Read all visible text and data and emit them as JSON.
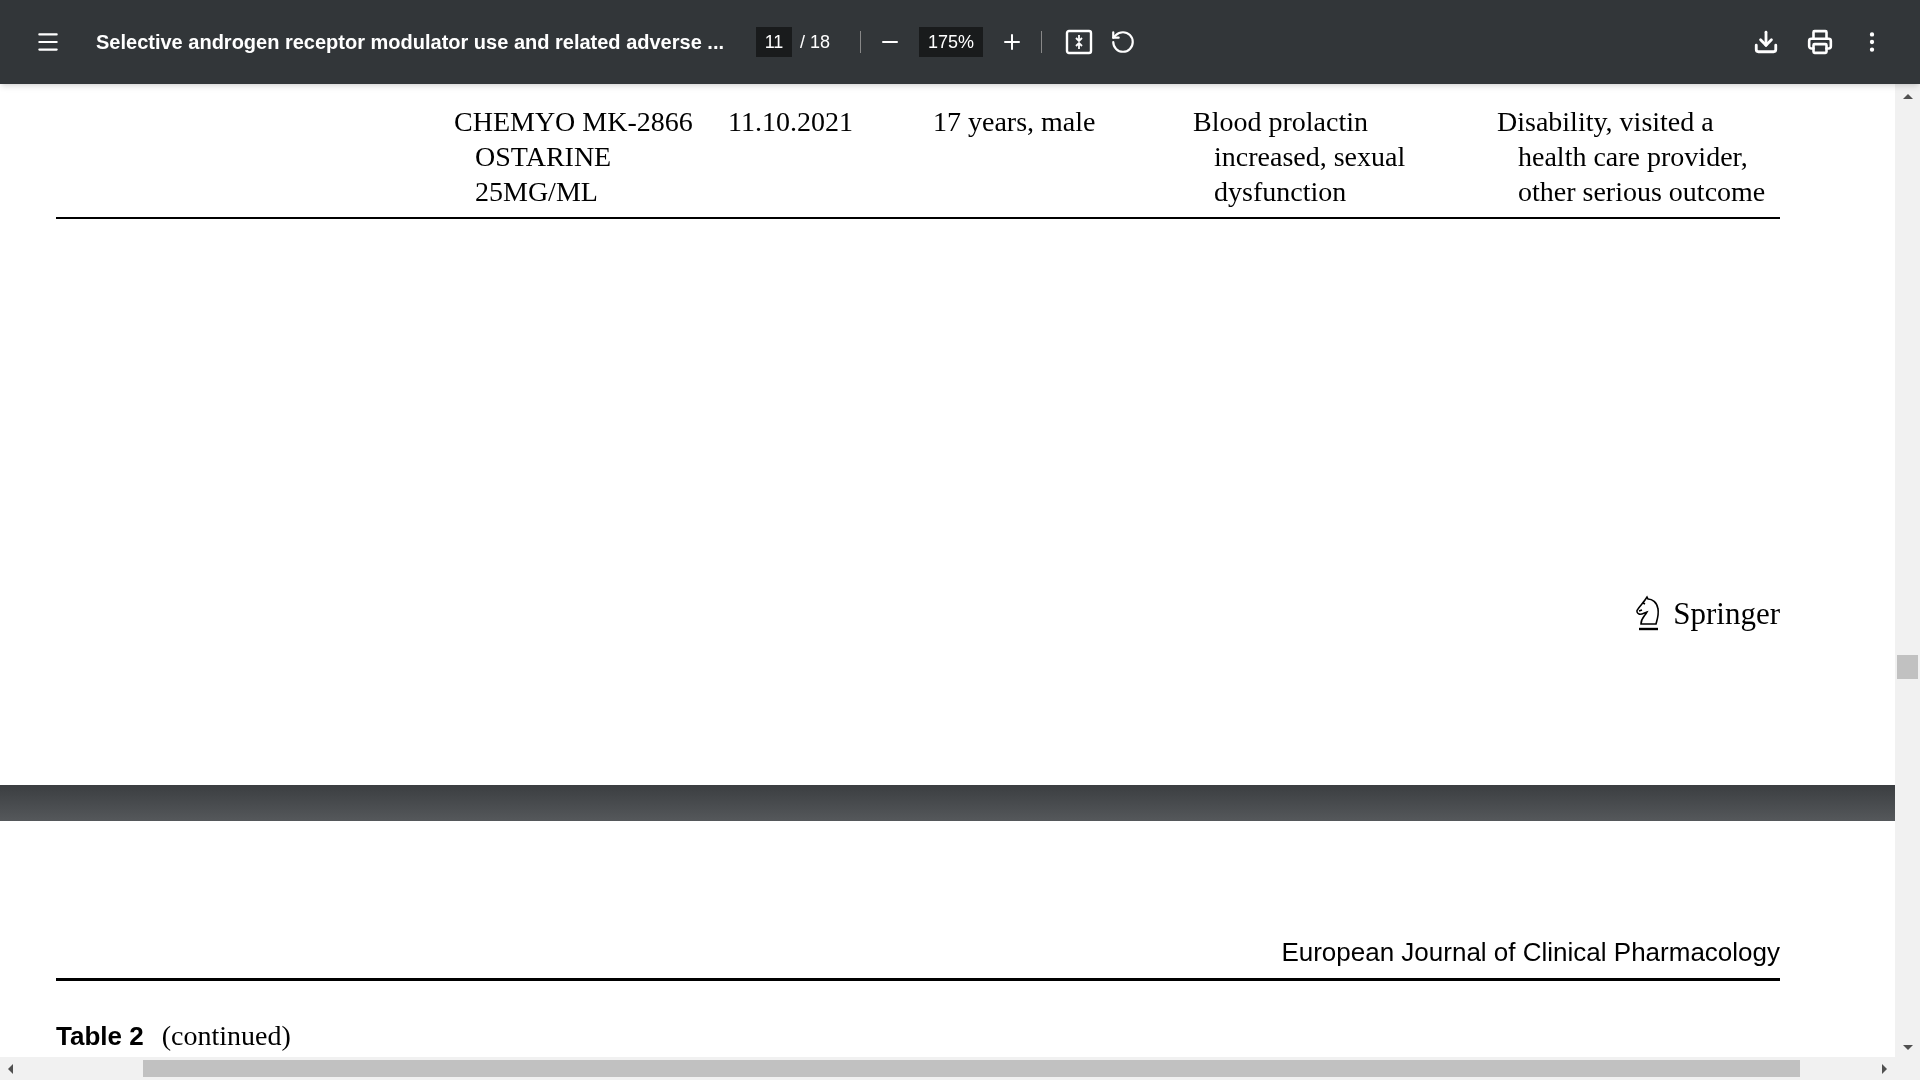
{
  "toolbar": {
    "title": "Selective androgen receptor modulator use and related adverse ...",
    "page_number": "11",
    "page_count": "/ 18",
    "zoom": "175%"
  },
  "table_rows": [
    {
      "cells": [
        "CHEMYO MK-2866 OSTARINE 25MG/ML",
        "11.10.2021",
        "17 years, male",
        "Blood prolactin increased, sexual dysfunction",
        "Disability, visited a health care provider, other serious outcome"
      ]
    }
  ],
  "page_footer": {
    "publisher": "Springer"
  },
  "next_page": {
    "running_header": "European Journal of Clinical Pharmacology",
    "table_label": "Table 2",
    "table_caption": "(continued)"
  }
}
